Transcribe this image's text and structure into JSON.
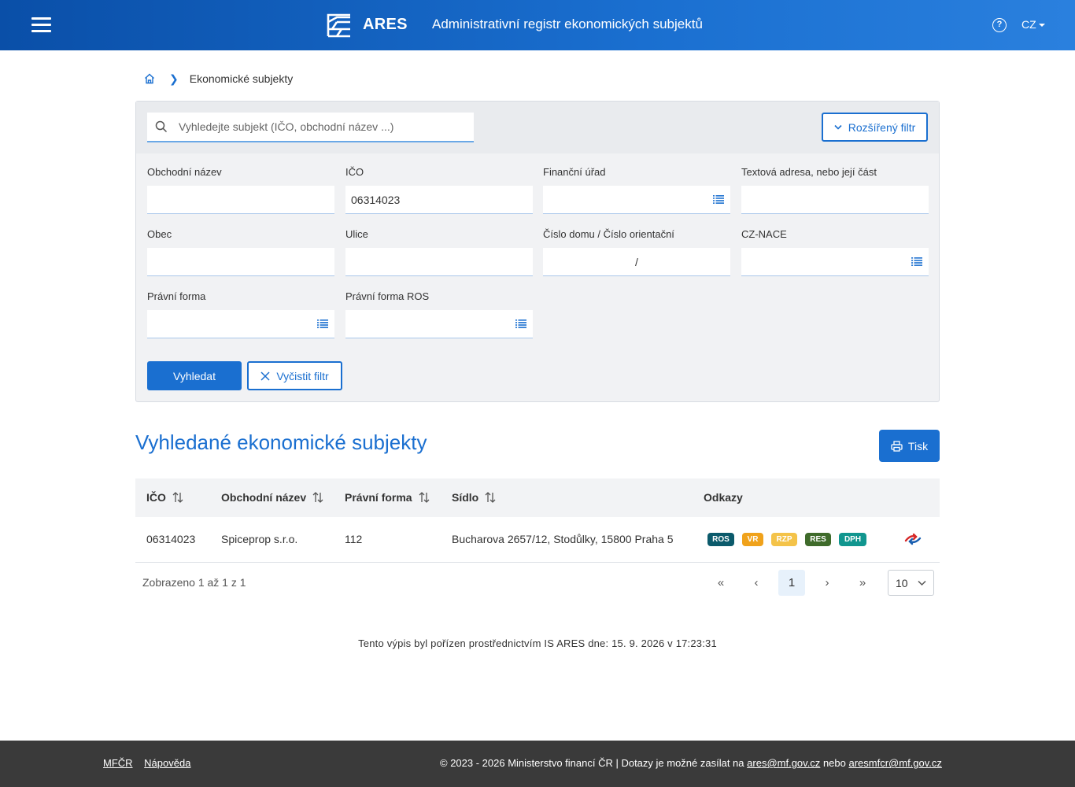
{
  "header": {
    "logo_text": "ARES",
    "title": "Administrativní registr ekonomických subjektů",
    "help_symbol": "?",
    "language": "CZ",
    "colors": {
      "bg_start": "#0a4fa8",
      "bg_end": "#2a80de"
    }
  },
  "breadcrumb": {
    "current": "Ekonomické subjekty"
  },
  "search": {
    "placeholder": "Vyhledejte subjekt (IČO, obchodní název ...)",
    "value": ""
  },
  "filter": {
    "advanced_label": "Rozšířený filtr",
    "fields": {
      "obchodni_nazev": {
        "label": "Obchodní název",
        "value": ""
      },
      "ico": {
        "label": "IČO",
        "value": "06314023"
      },
      "financni_urad": {
        "label": "Finanční úřad",
        "value": ""
      },
      "textova_adresa": {
        "label": "Textová adresa, nebo její část",
        "value": ""
      },
      "obec": {
        "label": "Obec",
        "value": ""
      },
      "ulice": {
        "label": "Ulice",
        "value": ""
      },
      "cislo_domu": {
        "label": "Číslo domu / Číslo orientační",
        "separator": "/"
      },
      "cz_nace": {
        "label": "CZ-NACE",
        "value": ""
      },
      "pravni_forma": {
        "label": "Právní forma",
        "value": ""
      },
      "pravni_forma_ros": {
        "label": "Právní forma ROS",
        "value": ""
      }
    },
    "search_button": "Vyhledat",
    "clear_button": "Vyčistit filtr"
  },
  "results": {
    "title": "Vyhledané ekonomické subjekty",
    "print_button": "Tisk",
    "columns": [
      "IČO",
      "Obchodní název",
      "Právní forma",
      "Sídlo",
      "Odkazy"
    ],
    "rows": [
      {
        "ico": "06314023",
        "nazev": "Spiceprop s.r.o.",
        "pravni_forma": "112",
        "sidlo": "Bucharova 2657/12, Stodůlky, 15800 Praha 5",
        "badges": [
          {
            "label": "ROS",
            "color": "#0b5a6b"
          },
          {
            "label": "VR",
            "color": "#f0a21b"
          },
          {
            "label": "RZP",
            "color": "#f4c349"
          },
          {
            "label": "RES",
            "color": "#3f6b2b"
          },
          {
            "label": "DPH",
            "color": "#11968f"
          }
        ]
      }
    ],
    "shown_text": "Zobrazeno 1 až 1 z 1",
    "pagination": {
      "first": "«",
      "prev": "‹",
      "current": "1",
      "next": "›",
      "last": "»",
      "page_size": "10"
    }
  },
  "note": "Tento výpis byl pořízen prostřednictvím IS ARES dne: 15. 9. 2026 v 17:23:31",
  "footer": {
    "link_mfcr": "MFČR",
    "link_help": "Nápověda",
    "copyright": "© 2023 - 2026 Ministerstvo financí ČR | Dotazy je možné zasílat na",
    "email1": "ares@mf.gov.cz",
    "conj": "nebo",
    "email2": "aresmfcr@mf.gov.cz"
  }
}
